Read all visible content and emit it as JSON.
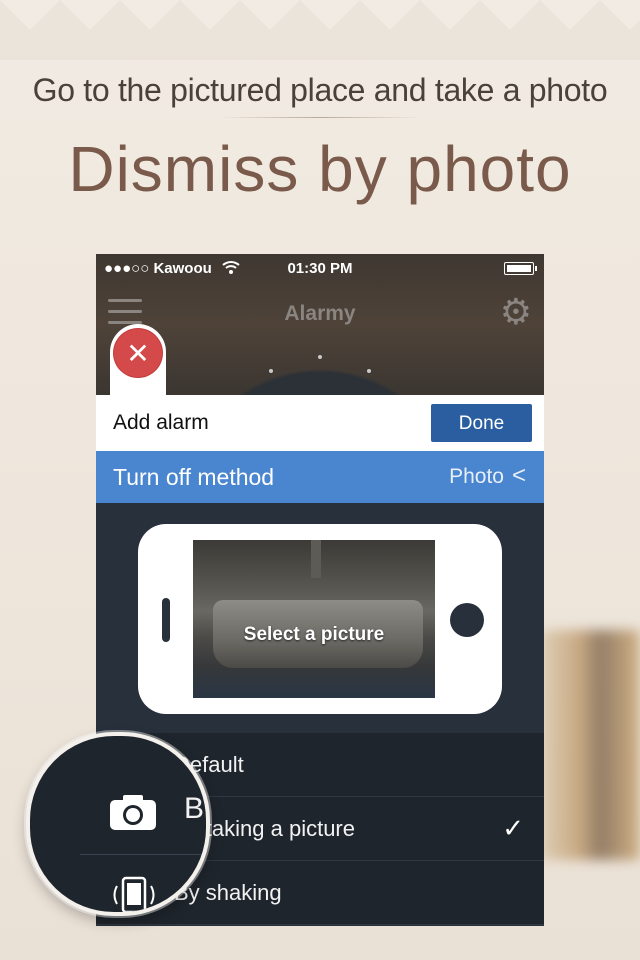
{
  "promo": {
    "subtitle": "Go to the pictured place and take a photo",
    "title": "Dismiss by photo"
  },
  "status_bar": {
    "carrier": "●●●○○ Kawoou",
    "time": "01:30 PM"
  },
  "app_header": {
    "app_name": "Alarmy"
  },
  "close_button_glyph": "✕",
  "add_alarm": {
    "label": "Add alarm",
    "done_label": "Done"
  },
  "turn_off": {
    "label": "Turn off method",
    "value": "Photo",
    "chevron": "<"
  },
  "photo_preview": {
    "label": "Select a picture"
  },
  "methods": [
    {
      "label": "Default",
      "selected": false
    },
    {
      "label": "By taking a picture",
      "selected": true
    },
    {
      "label": "By shaking",
      "selected": false
    }
  ],
  "check_glyph": "✓",
  "zoom_letter": "B",
  "colors": {
    "blue_header": "#4a86cf",
    "done_button": "#2a5ea0",
    "close_red": "#d44949",
    "panel_dark": "#27303b",
    "title_brown": "#7a5a4a"
  },
  "icons": [
    "menu-icon",
    "gear-icon",
    "wifi-icon",
    "battery-icon",
    "close-icon",
    "chevron-left-icon",
    "checkmark-icon",
    "camera-icon",
    "shake-phone-icon"
  ]
}
